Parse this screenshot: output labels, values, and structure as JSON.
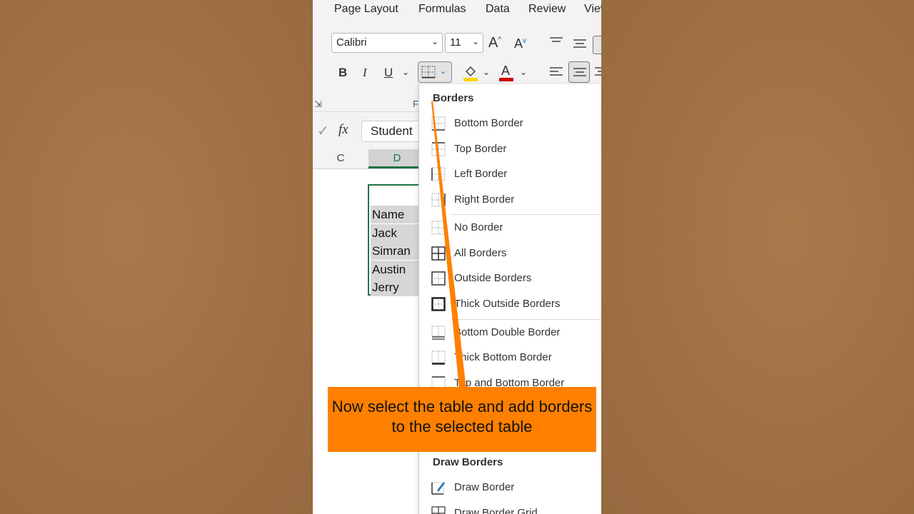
{
  "ribbon": {
    "tabs": [
      "Page Layout",
      "Formulas",
      "Data",
      "Review",
      "View"
    ],
    "font_name": "Calibri",
    "font_size": "11",
    "group_label": "F"
  },
  "formula_bar": {
    "content": "Student"
  },
  "columns": [
    "C",
    "D"
  ],
  "cells": [
    "Name",
    "Jack",
    "Simran",
    "Austin",
    "Jerry"
  ],
  "borders_menu": {
    "title": "Borders",
    "items": [
      "Bottom Border",
      "Top Border",
      "Left Border",
      "Right Border",
      "No Border",
      "All Borders",
      "Outside Borders",
      "Thick Outside Borders",
      "Bottom Double Border",
      "Thick Bottom Border",
      "Top and Bottom Border"
    ],
    "draw_title": "Draw Borders",
    "draw_items": [
      "Draw Border",
      "Draw Border Grid"
    ]
  },
  "callout": {
    "text": "Now select the table and add borders to the selected table"
  },
  "colors": {
    "excel_green": "#217346",
    "callout_orange": "#ff8000",
    "highlight_yellow": "#ffd800",
    "font_red": "#d00000",
    "background_brown": "#a07044"
  }
}
